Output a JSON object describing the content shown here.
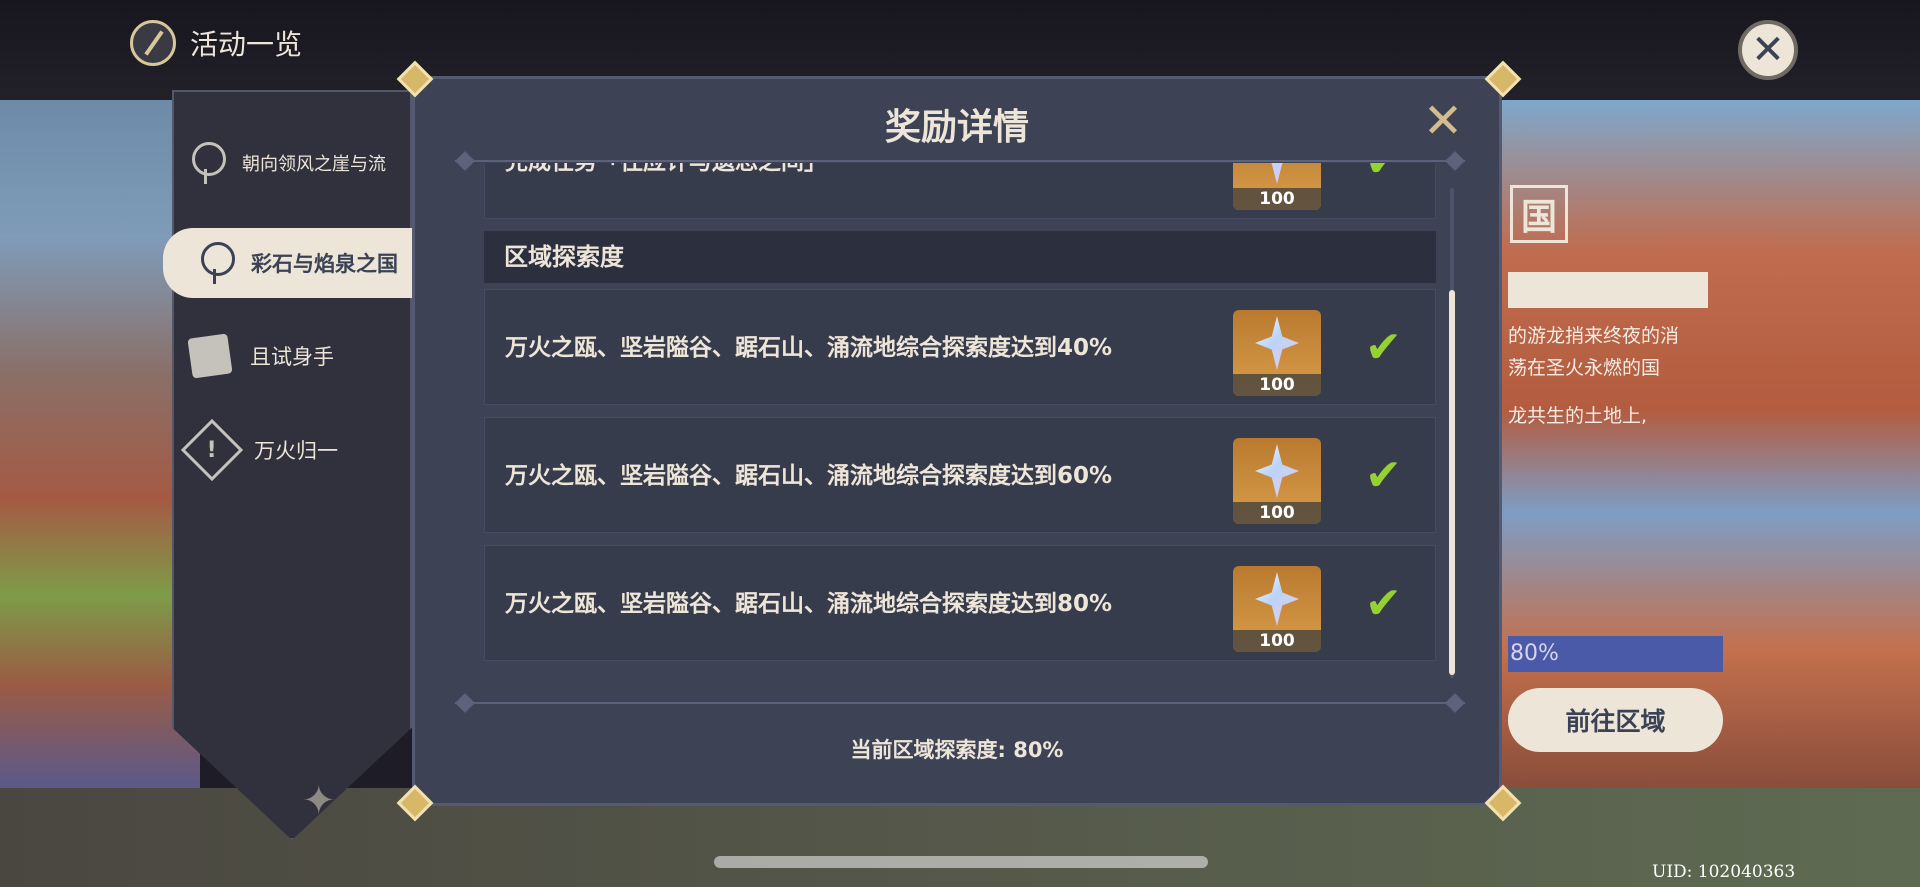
{
  "header": {
    "title": "活动一览",
    "close_icon": "close-icon"
  },
  "sidebar": {
    "items": [
      {
        "label": "朝向领风之崖与流",
        "icon": "map-pin-icon"
      },
      {
        "label": "彩石与焰泉之国",
        "icon": "map-pin-icon"
      },
      {
        "label": "且试身手",
        "icon": "cards-icon"
      },
      {
        "label": "万火归一",
        "icon": "warning-icon"
      }
    ]
  },
  "region_panel": {
    "title_char": "国",
    "desc_lines": [
      "的游龙捎来终夜的消",
      "荡在圣火永燃的国",
      "龙共生的土地上,"
    ],
    "progress_text": "80%",
    "go_button": "前往区域"
  },
  "modal": {
    "title": "奖励详情",
    "partial_task": "完成任务「往应许与遗忘之间」",
    "section_title": "区域探索度",
    "tasks": [
      {
        "text": "万火之瓯、坚岩隘谷、踞石山、涌流地综合探索度达到40%",
        "reward": "100",
        "completed": true
      },
      {
        "text": "万火之瓯、坚岩隘谷、踞石山、涌流地综合探索度达到60%",
        "reward": "100",
        "completed": true
      },
      {
        "text": "万火之瓯、坚岩隘谷、踞石山、涌流地综合探索度达到80%",
        "reward": "100",
        "completed": true
      }
    ],
    "partial_reward": "100",
    "footer": "当前区域探索度: 80%"
  },
  "uid": "UID: 102040363",
  "colors": {
    "panel_bg": "#3d4255",
    "row_bg": "#373c4d",
    "text_cream": "#ece5d8",
    "gold": "#d3bc8e",
    "check_green": "#95d22f"
  }
}
